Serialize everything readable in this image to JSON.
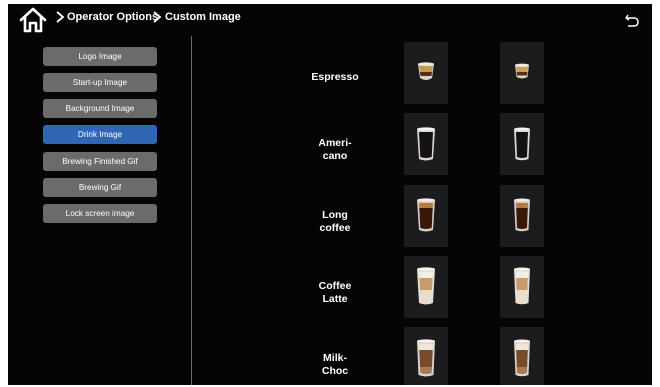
{
  "header": {
    "home_icon": "home-icon",
    "crumbs": [
      "Operator Options",
      "Custom Image"
    ],
    "back_icon": "return-arrow-icon"
  },
  "sidebar": {
    "items": [
      {
        "label": "Logo Image",
        "active": false
      },
      {
        "label": "Start-up Image",
        "active": false
      },
      {
        "label": "Background Image",
        "active": false
      },
      {
        "label": "Drink Image",
        "active": true
      },
      {
        "label": "Brewing Finished Gif",
        "active": false
      },
      {
        "label": "Brewing Gif",
        "active": false
      },
      {
        "label": "Lock screen image",
        "active": false
      }
    ]
  },
  "drinks": [
    {
      "name": "Espresso",
      "cup": "espresso-cup-icon"
    },
    {
      "name": "Ameri-\ncano",
      "cup": "americano-glass-icon"
    },
    {
      "name": "Long\ncoffee",
      "cup": "long-coffee-glass-icon"
    },
    {
      "name": "Coffee\nLatte",
      "cup": "latte-glass-icon"
    },
    {
      "name": "Milk-\nChoc",
      "cup": "milk-choc-glass-icon"
    }
  ],
  "colors": {
    "background": "#050505",
    "button": "#6b6b6b",
    "button_active": "#2f67b5",
    "tile": "#1c1c1f"
  }
}
